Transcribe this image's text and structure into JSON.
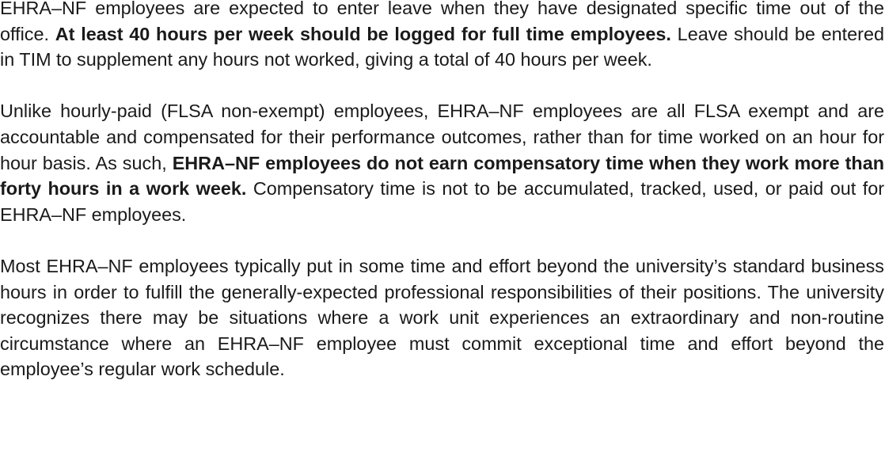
{
  "paragraphs": [
    {
      "segments": [
        {
          "text": "EHRA–NF employees are expected to enter leave when they have designated specific time out of the office. ",
          "bold": false
        },
        {
          "text": "At least 40 hours per week should be logged for full time employees.",
          "bold": true
        },
        {
          "text": " Leave should be entered in TIM to supplement any hours not worked, giving a total of 40 hours per week.",
          "bold": false
        }
      ]
    },
    {
      "segments": [
        {
          "text": "Unlike hourly-paid (FLSA non-exempt) employees, EHRA–NF employees are all FLSA exempt and are accountable and compensated for their performance outcomes, rather than for time worked on an hour for hour basis. As such, ",
          "bold": false
        },
        {
          "text": "EHRA–NF employees do not earn compensatory time when they work more than forty hours in a work week.",
          "bold": true
        },
        {
          "text": " Compensatory time is not to be accumulated, tracked, used, or paid out for EHRA–NF employees.",
          "bold": false
        }
      ]
    },
    {
      "segments": [
        {
          "text": "Most EHRA–NF employees typically put in some time and effort beyond the university’s stan­dard business hours in order to fulfill the generally-expected professional responsibilities of their positions. The university recognizes there may be situations where a work unit experiences an extraordinary and non-routine circumstance where an EHRA–NF employee must commit excep­tional time and effort beyond the employee’s regular work schedule.",
          "bold": false
        }
      ]
    }
  ]
}
